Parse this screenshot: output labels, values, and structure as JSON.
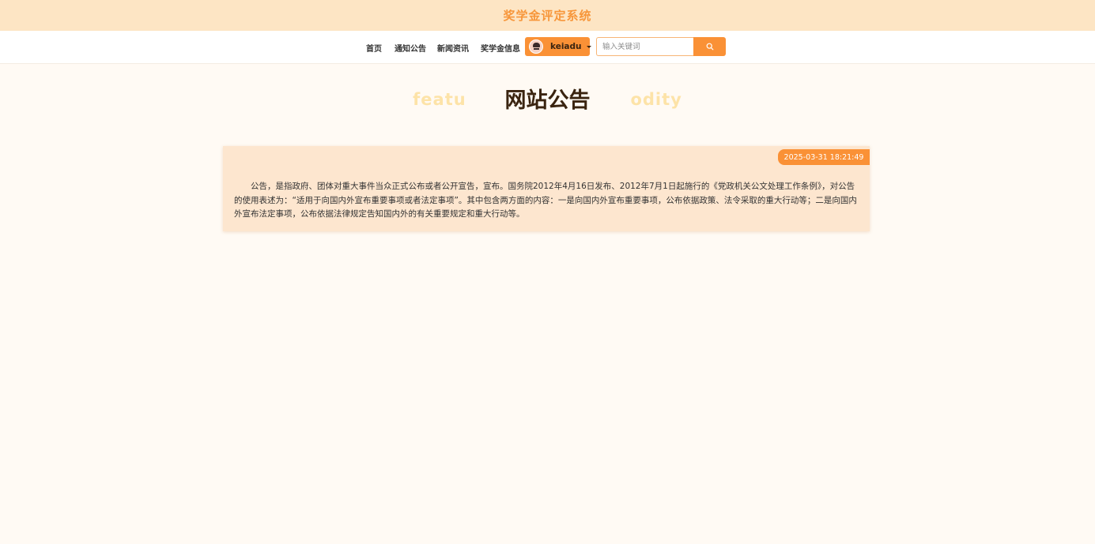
{
  "site": {
    "title": "奖学金评定系统"
  },
  "nav": {
    "items": [
      {
        "label": "首页"
      },
      {
        "label": "通知公告"
      },
      {
        "label": "新闻资讯"
      },
      {
        "label": "奖学金信息"
      }
    ],
    "user": {
      "name": "keiadu"
    },
    "search": {
      "placeholder": "输入关键词"
    }
  },
  "page": {
    "heading": "网站公告",
    "heading_bg": "featu                         odity"
  },
  "notice": {
    "date": "2025-03-31 18:21:49",
    "content": "公告，是指政府、团体对重大事件当众正式公布或者公开宣告，宣布。国务院2012年4月16日发布、2012年7月1日起施行的《党政机关公文处理工作条例》，对公告的使用表述为：“适用于向国内外宣布重要事项或者法定事项”。其中包含两方面的内容：一是向国内外宣布重要事项，公布依据政策、法令采取的重大行动等；二是向国内外宣布法定事项，公布依据法律规定告知国内外的有关重要规定和重大行动等。"
  },
  "colors": {
    "accent": "#fa9136",
    "topbar": "#fde5c4",
    "card": "#fde6cf"
  }
}
